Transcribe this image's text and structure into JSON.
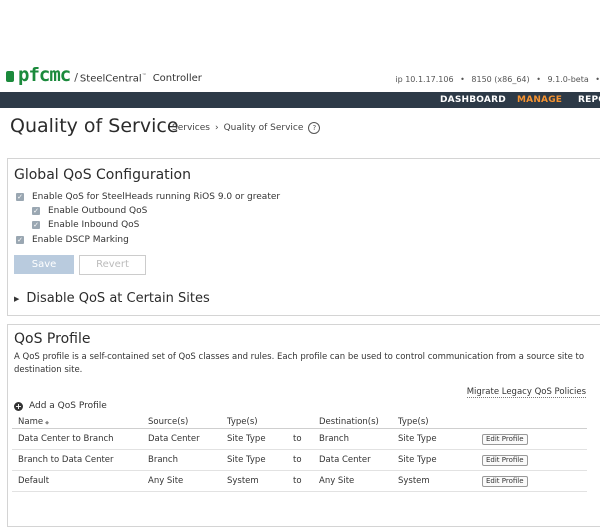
{
  "header": {
    "logo_text": "pfcmc",
    "logo_slash": "/",
    "product": "SteelCentral",
    "product_tm": "™",
    "subtitle": "Controller",
    "ip": "ip 10.1.17.106",
    "build": "8150 (x86_64)",
    "version": "9.1.0-beta",
    "version_sep1": "•",
    "version_sep2": "•",
    "version_sep3": "•"
  },
  "nav": {
    "items": [
      "DASHBOARD",
      "MANAGE",
      "REPO"
    ]
  },
  "page": {
    "title": "Quality of Service",
    "breadcrumb_1": "Services",
    "breadcrumb_sep": "›",
    "breadcrumb_2": "Quality of Service",
    "help": "?"
  },
  "global_qos": {
    "title": "Global QoS Configuration",
    "options": [
      {
        "label": "Enable QoS for SteelHeads running RiOS 9.0 or greater",
        "checked": true
      },
      {
        "label": "Enable Outbound QoS",
        "checked": true
      },
      {
        "label": "Enable Inbound QoS",
        "checked": true
      },
      {
        "label": "Enable DSCP Marking",
        "checked": true
      }
    ],
    "check_glyph": "✓",
    "save_label": "Save",
    "revert_label": "Revert",
    "disable_sites_label": "Disable QoS at Certain Sites",
    "caret": "▶"
  },
  "qos_profile": {
    "title": "QoS Profile",
    "description": "A QoS profile is a self-contained set of QoS classes and rules. Each profile can be used to control communication from a source site to destination site.",
    "migrate_label": "Migrate Legacy QoS Policies",
    "add_label": "Add a QoS Profile",
    "plus": "+",
    "columns": [
      "Name",
      "Source(s)",
      "Type(s)",
      "",
      "Destination(s)",
      "Type(s)",
      ""
    ],
    "sort_glyph": "◆",
    "rows": [
      {
        "name": "Data Center to Branch",
        "source": "Data Center",
        "src_type": "Site Type",
        "to": "to",
        "dest": "Branch",
        "dest_type": "Site Type",
        "action": "Edit Profile"
      },
      {
        "name": "Branch to Data Center",
        "source": "Branch",
        "src_type": "Site Type",
        "to": "to",
        "dest": "Data Center",
        "dest_type": "Site Type",
        "action": "Edit Profile"
      },
      {
        "name": "Default",
        "source": "Any Site",
        "src_type": "System",
        "to": "to",
        "dest": "Any Site",
        "dest_type": "System",
        "action": "Edit Profile"
      }
    ]
  }
}
